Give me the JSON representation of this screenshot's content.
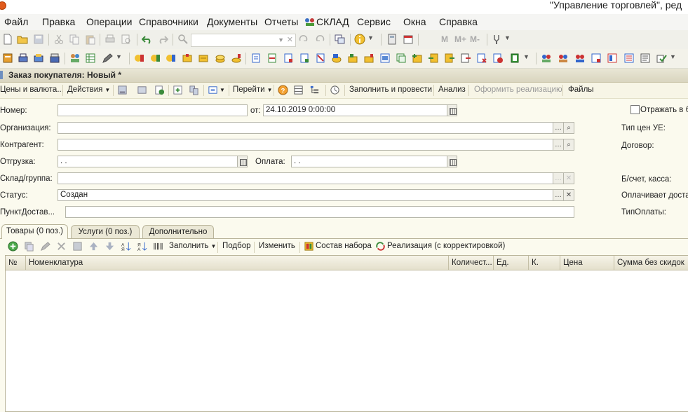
{
  "window": {
    "title": "\"Управление торговлей\", ред"
  },
  "menu": [
    "Файл",
    "Правка",
    "Операции",
    "Справочники",
    "Документы",
    "Отчеты",
    "СКЛАД",
    "Сервис",
    "Окна",
    "Справка"
  ],
  "toolbar1": {
    "m_labels": [
      "M",
      "M+",
      "M-"
    ]
  },
  "document": {
    "title": "Заказ покупателя: Новый *",
    "commands": {
      "prices": "Цены и валюта...",
      "actions": "Действия",
      "goto": "Перейти",
      "fill_post": "Заполнить и провести",
      "analysis": "Анализ",
      "make_sale": "Оформить реализацию",
      "files": "Файлы"
    }
  },
  "form": {
    "number_label": "Номер:",
    "number_value": "",
    "date_label": "от:",
    "date_value": "24.10.2019  0:00:00",
    "reflect_label": "Отражать в б",
    "org_label": "Организация:",
    "org_value": "",
    "price_type_label": "Тип цен УЕ:",
    "counterparty_label": "Контрагент:",
    "counterparty_value": "",
    "contract_label": "Договор:",
    "shipment_label": "Отгрузка:",
    "shipment_value": " .  .",
    "payment_label": "Оплата:",
    "payment_value": " .  .",
    "warehouse_label": "Склад/группа:",
    "warehouse_value": "",
    "account_label": "Б/счет, касса:",
    "status_label": "Статус:",
    "status_value": "Создан",
    "payer_label": "Оплачивает достав",
    "delivery_point_label": "ПунктДостав...",
    "delivery_point_value": "",
    "payment_type_label": "ТипОплаты:"
  },
  "tabs": [
    "Товары (0 поз.)",
    "Услуги (0 поз.)",
    "Дополнительно"
  ],
  "grid_toolbar": {
    "fill": "Заполнить",
    "selection": "Подбор",
    "change": "Изменить",
    "kit": "Состав набора",
    "sale_correction": "Реализация (с корректировкой)"
  },
  "grid": {
    "columns": [
      "№",
      "Номенклатура",
      "Количест...",
      "Ед.",
      "К.",
      "Цена",
      "Сумма без скидок"
    ],
    "rows": []
  },
  "colors": {
    "window_bg": "#fbfaee",
    "toolbar_bg": "#f0f0ea",
    "header_bg": "#e4e0cc"
  }
}
